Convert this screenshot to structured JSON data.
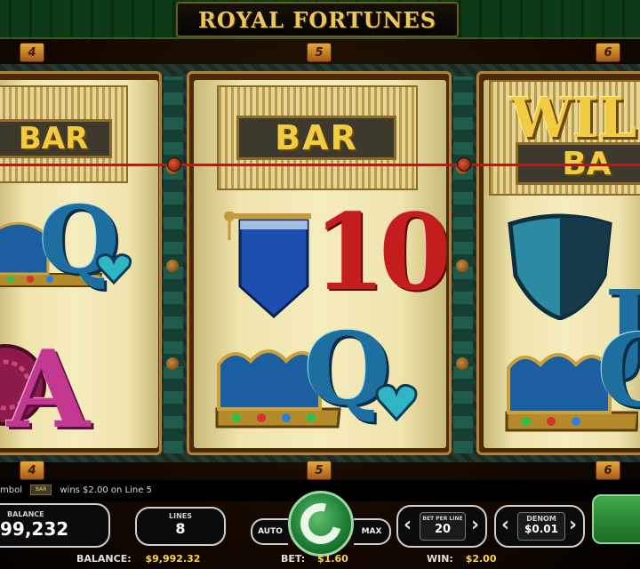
{
  "title": "ROYAL FORTUNES",
  "line_markers": {
    "top": [
      "4",
      "5",
      "6"
    ],
    "bottom": [
      "4",
      "5",
      "6"
    ]
  },
  "reels": {
    "left": {
      "bar": "BAR",
      "mid": "Q",
      "low": "A"
    },
    "middle": {
      "bar": "BAR",
      "mid": "10",
      "low": "Q"
    },
    "right": {
      "wild": "WIL",
      "bar": "BA",
      "mid": "J",
      "low": "Q"
    }
  },
  "info": {
    "symbol_label": "mbol",
    "win_text": "wins $2.00 on Line 5"
  },
  "controls": {
    "balance_label": "BALANCE",
    "balance_value": "99,232",
    "lines_label": "LINES",
    "lines_value": "8",
    "auto_label": "AUTO",
    "max_label": "MAX",
    "bet_per_line_label": "BET PER LINE",
    "bet_per_line_value": "20",
    "denom_label": "DENOM",
    "denom_value": "$0.01"
  },
  "footer": {
    "balance_label": "BALANCE:",
    "balance_value": "$9,992.32",
    "bet_label": "BET:",
    "bet_value": "$1.60",
    "win_label": "WIN:",
    "win_value": "$2.00"
  },
  "colors": {
    "gold": "#e9c760",
    "payline": "#b31a1a",
    "spin_green": "#1f8137"
  }
}
